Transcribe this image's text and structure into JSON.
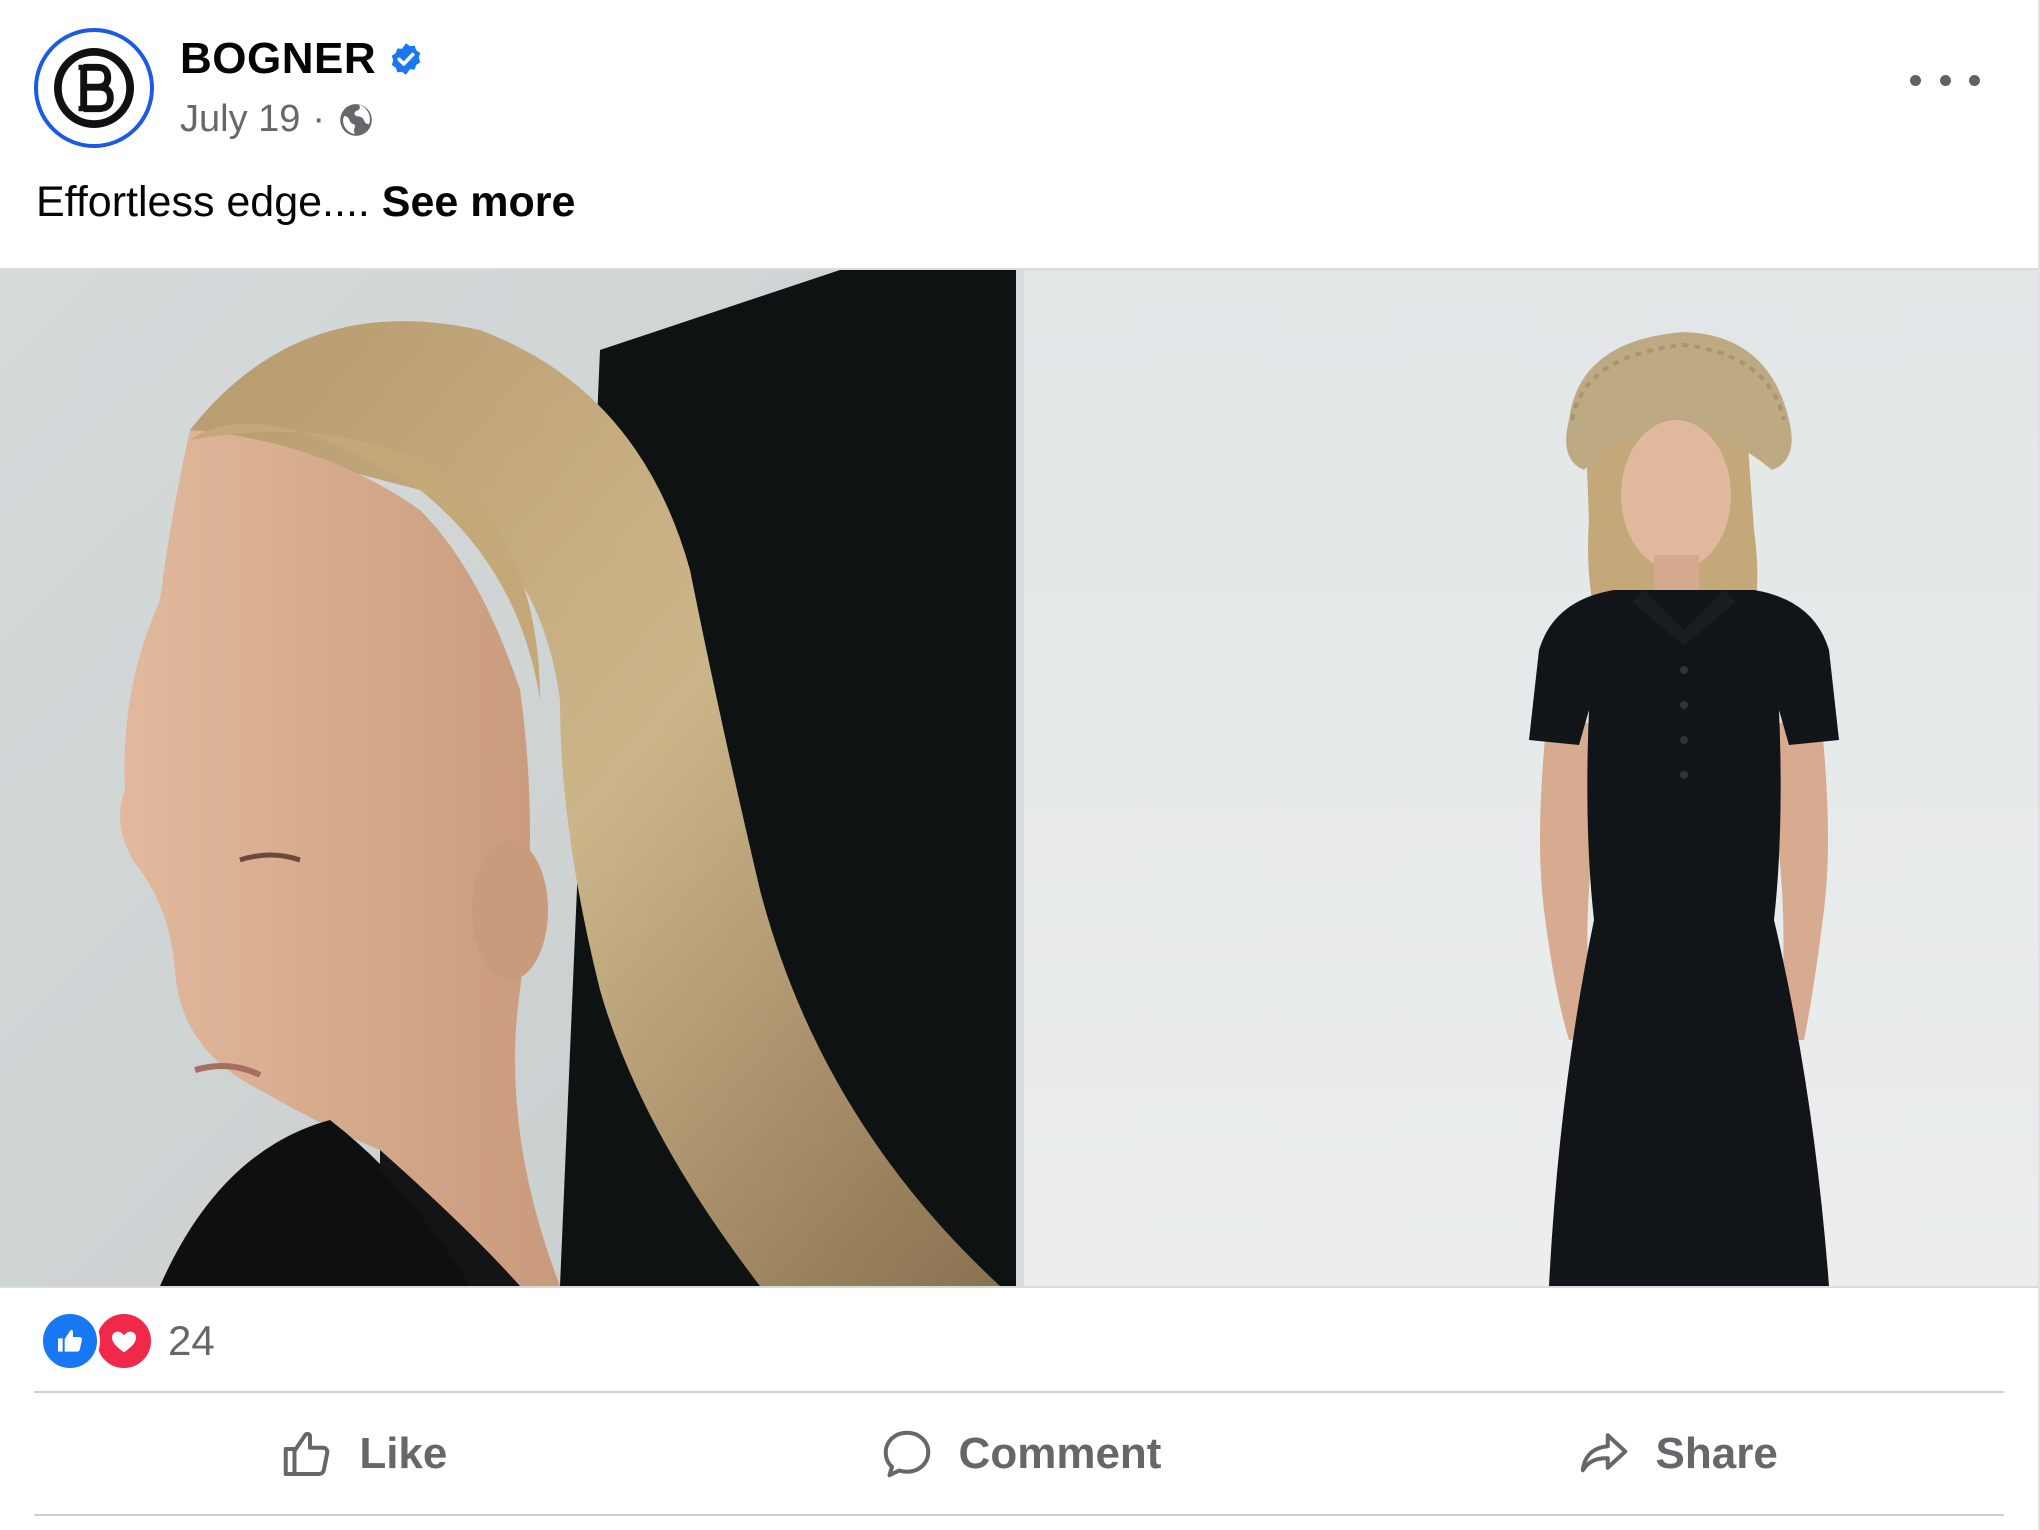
{
  "post": {
    "page_name": "BOGNER",
    "verified": true,
    "date": "July 19",
    "separator": "·",
    "audience_icon": "globe-icon",
    "more_icon": "more-options-icon",
    "caption_text": "Effortless edge.... ",
    "see_more_label": "See more"
  },
  "photos": [
    {
      "subject": "profile portrait of model with long blonde hair in black collared top"
    },
    {
      "subject": "model in straw bucket hat wearing black polo midi dress"
    }
  ],
  "reactions": {
    "icons": [
      "like-reaction-icon",
      "love-reaction-icon"
    ],
    "count": "24"
  },
  "actions": {
    "like_label": "Like",
    "comment_label": "Comment",
    "share_label": "Share"
  },
  "colors": {
    "brand_blue": "#1877f2",
    "avatar_ring": "#1b5ae6",
    "love_red": "#f02849",
    "secondary_text": "#65676b"
  }
}
